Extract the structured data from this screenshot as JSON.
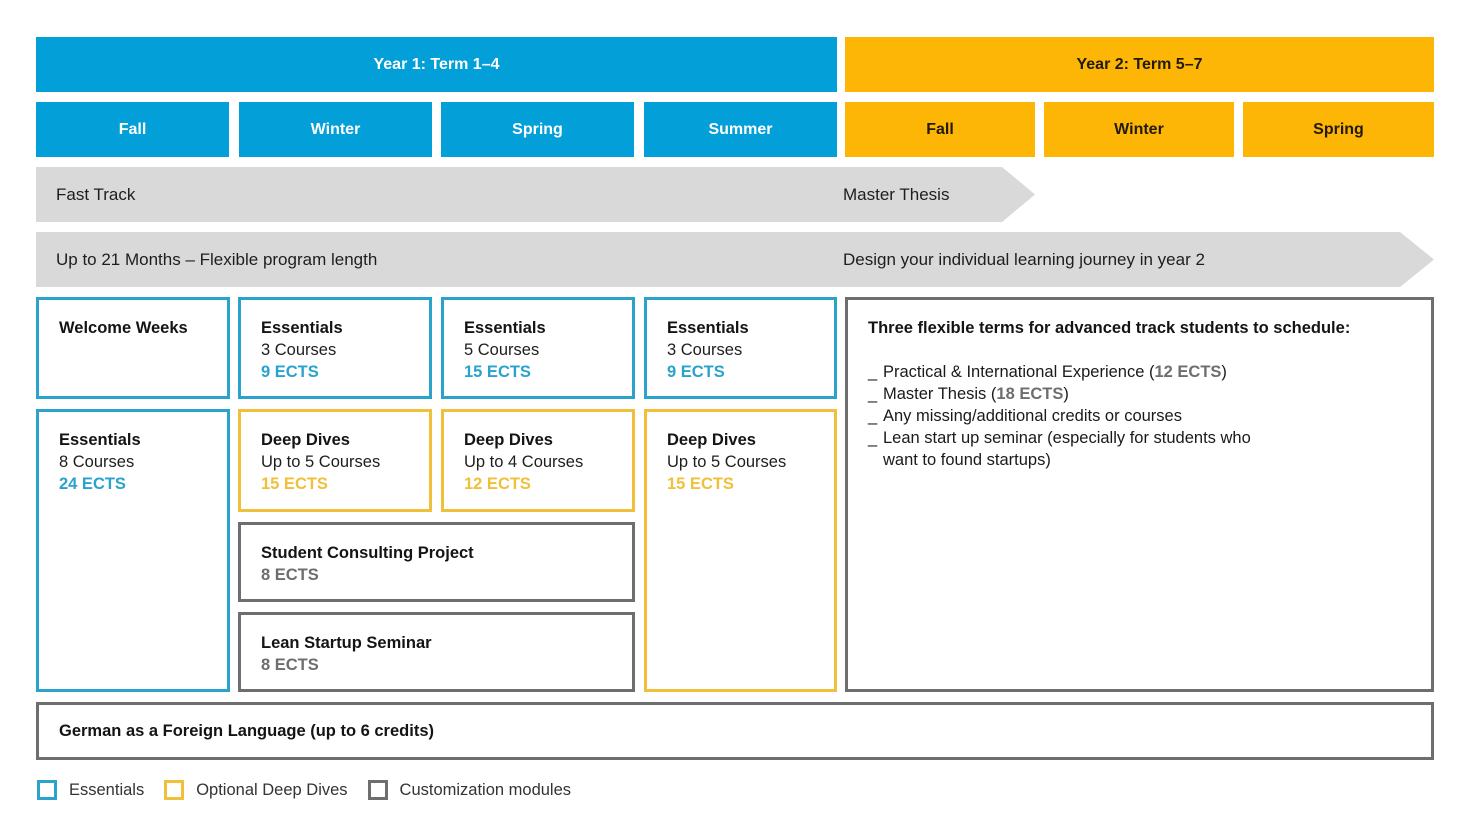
{
  "colors": {
    "year1": "#039fd8",
    "year2": "#fdb606",
    "essentials": "#2aa3cc",
    "deep_dives": "#f0c03a",
    "customization": "#6e6e6e",
    "track": "#d9d9d9"
  },
  "years": [
    {
      "label": "Year 1: Term 1–4",
      "terms": [
        "Fall",
        "Winter",
        "Spring",
        "Summer"
      ]
    },
    {
      "label": "Year 2: Term 5–7",
      "terms": [
        "Fall",
        "Winter",
        "Spring"
      ]
    }
  ],
  "tracks": {
    "fast": {
      "left": "Fast Track",
      "right": "Master Thesis"
    },
    "flexible": {
      "left": "Up to 21 Months – Flexible program length",
      "right": "Design your individual learning journey in year 2"
    }
  },
  "modules": {
    "welcome": {
      "title": "Welcome Weeks"
    },
    "ess_fall": {
      "title": "Essentials",
      "sub": "8 Courses",
      "ects": "24 ECTS"
    },
    "ess_winter": {
      "title": "Essentials",
      "sub": "3 Courses",
      "ects": "9 ECTS"
    },
    "ess_spring": {
      "title": "Essentials",
      "sub": "5 Courses",
      "ects": "15 ECTS"
    },
    "ess_summer": {
      "title": "Essentials",
      "sub": "3 Courses",
      "ects": "9 ECTS"
    },
    "dd_winter": {
      "title": "Deep Dives",
      "sub": "Up to 5 Courses",
      "ects": "15 ECTS"
    },
    "dd_spring": {
      "title": "Deep Dives",
      "sub": "Up to 4 Courses",
      "ects": "12 ECTS"
    },
    "dd_summer": {
      "title": "Deep Dives",
      "sub": "Up to 5 Courses",
      "ects": "15 ECTS"
    },
    "consulting": {
      "title": "Student Consulting Project",
      "ects": "8 ECTS"
    },
    "lean": {
      "title": "Lean Startup Seminar",
      "ects": "8 ECTS"
    },
    "german": {
      "title": "German as a Foreign Language (up to 6 credits)"
    }
  },
  "year2_box": {
    "title": "Three flexible terms for advanced track students to schedule:",
    "bullet": "_",
    "items": [
      {
        "text": "Practical & International Experience (",
        "ects": "12 ECTS",
        "after": ")"
      },
      {
        "text": "Master Thesis (",
        "ects": "18 ECTS",
        "after": ")"
      },
      {
        "text": "Any missing/additional credits or courses",
        "ects": "",
        "after": ""
      },
      {
        "text": "Lean start up seminar (especially for students who want to found startups)",
        "ects": "",
        "after": ""
      }
    ]
  },
  "legend": [
    {
      "label": "Essentials",
      "icon": "blue-square-outline"
    },
    {
      "label": "Optional Deep Dives",
      "icon": "gold-square-outline"
    },
    {
      "label": "Customization modules",
      "icon": "gray-square-outline"
    }
  ]
}
